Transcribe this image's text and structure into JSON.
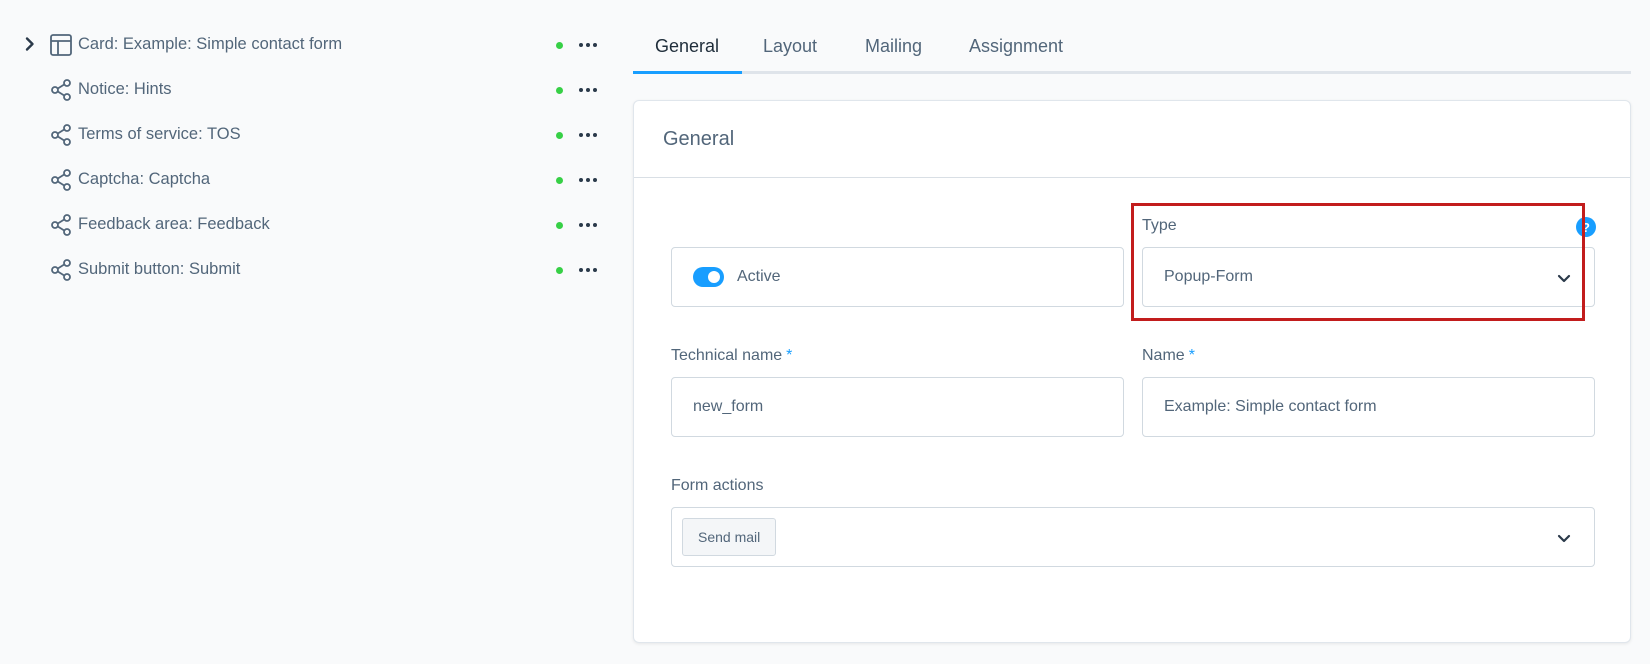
{
  "tree": {
    "items": [
      {
        "label": "Card: Example: Simple contact form",
        "icon": "layout-icon",
        "expandable": true
      },
      {
        "label": "Notice: Hints",
        "icon": "share-icon",
        "expandable": false
      },
      {
        "label": "Terms of service: TOS",
        "icon": "share-icon",
        "expandable": false
      },
      {
        "label": "Captcha: Captcha",
        "icon": "share-icon",
        "expandable": false
      },
      {
        "label": "Feedback area: Feedback",
        "icon": "share-icon",
        "expandable": false
      },
      {
        "label": "Submit button: Submit",
        "icon": "share-icon",
        "expandable": false
      }
    ]
  },
  "tabs": [
    {
      "label": "General",
      "active": true
    },
    {
      "label": "Layout",
      "active": false
    },
    {
      "label": "Mailing",
      "active": false
    },
    {
      "label": "Assignment",
      "active": false
    }
  ],
  "card": {
    "title": "General",
    "active_toggle": {
      "label": "Active",
      "checked": true
    },
    "type": {
      "label": "Type",
      "value": "Popup-Form",
      "help_icon": "?"
    },
    "technical_name": {
      "label": "Technical name",
      "required_mark": "*",
      "value": "new_form"
    },
    "name": {
      "label": "Name",
      "required_mark": "*",
      "value": "Example: Simple contact form"
    },
    "form_actions": {
      "label": "Form actions",
      "chips": [
        "Send mail"
      ]
    }
  },
  "colors": {
    "accent": "#189eff",
    "status_active": "#37d046",
    "highlight_border": "#c21d1d",
    "text": "#52667a"
  }
}
